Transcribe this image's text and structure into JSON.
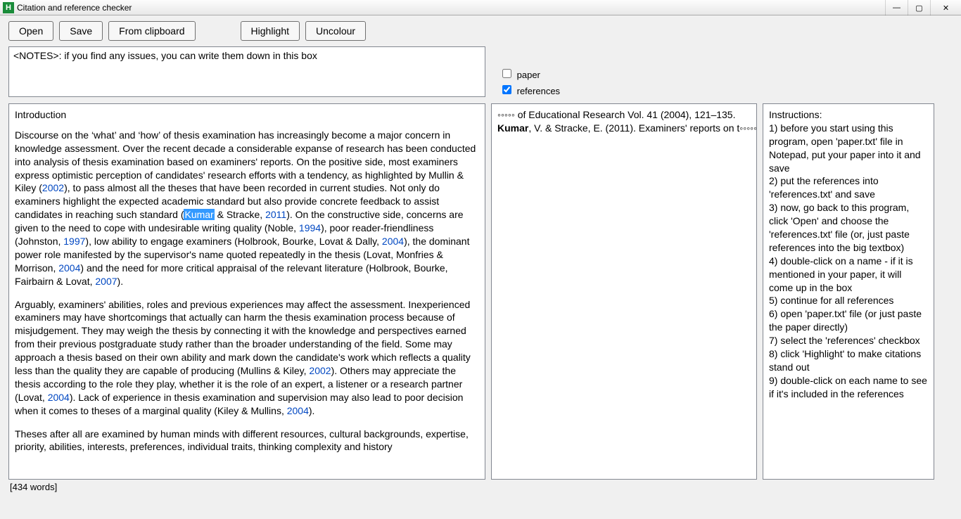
{
  "window": {
    "title": "Citation and reference checker",
    "icon_letter": "H"
  },
  "toolbar": {
    "open": "Open",
    "save": "Save",
    "from_clipboard": "From clipboard",
    "highlight": "Highlight",
    "uncolour": "Uncolour"
  },
  "notes_value": "<NOTES>: if you find any issues, you can write them down in this box",
  "checkboxes": {
    "paper_label": "paper",
    "paper_checked": false,
    "references_label": "references",
    "references_checked": true
  },
  "paper": {
    "heading": "Introduction",
    "p1a": "Discourse on the ‘what’ and ‘how’ of thesis examination has increasingly become a major concern in knowledge assessment. Over the recent decade a considerable expanse of research has been conducted into analysis of thesis examination based on examiners' reports. On the positive side, most examiners express optimistic perception of candidates' research efforts with a tendency, as highlighted by Mullin & Kiley (",
    "c1": "2002",
    "p1b": "), to pass almost all the theses that have been recorded in current studies. Not only do examiners highlight the expected academic standard but also provide concrete feedback to assist candidates in reaching such standard (",
    "c2": "Kumar",
    "p1c": " & Stracke, ",
    "c3": "2011",
    "p1d": "). On the constructive side, concerns are given to the need to cope with undesirable writing quality (Noble, ",
    "c4": "1994",
    "p1e": "), poor reader-friendliness (Johnston, ",
    "c5": "1997",
    "p1f": "), low ability to engage examiners (Holbrook, Bourke, Lovat & Dally, ",
    "c6": "2004",
    "p1g": "), the dominant power role manifested by the supervisor's name quoted repeatedly in the thesis (Lovat, Monfries & Morrison, ",
    "c7": "2004",
    "p1h": ") and the need for more critical appraisal of the relevant literature (Holbrook, Bourke, Fairbairn & Lovat, ",
    "c8": "2007",
    "p1i": ").",
    "p2a": "Arguably, examiners' abilities, roles and previous experiences may affect the assessment. Inexperienced examiners may have shortcomings that actually can harm the thesis examination process because of misjudgement. They may weigh the thesis by connecting it with the knowledge and perspectives earned from their previous postgraduate study rather than the broader understanding of the field. Some may approach a thesis based on their own ability and mark down the candidate's work which reflects a quality less than the quality they are capable of producing (Mullins & Kiley, ",
    "c9": "2002",
    "p2b": "). Others may appreciate the thesis according to the role they play, whether it is the role of an expert, a listener or a research partner (Lovat, ",
    "c10": "2004",
    "p2c": "). Lack of experience in thesis examination and supervision may also lead to poor decision when it comes to theses of a marginal quality (Kiley & Mullins, ",
    "c11": "2004",
    "p2d": ").",
    "p3": "Theses after all are examined by human minds with different resources, cultural backgrounds, expertise, priority, abilities, interests, preferences, individual traits, thinking complexity and history"
  },
  "references": {
    "line1": "◦◦◦◦◦ of Educational Research Vol. 41 (2004), 121–135.",
    "line2a": "Kumar",
    "line2b": ", V. & Stracke, E. (2011). Examiners' reports on t◦◦◦◦◦"
  },
  "instructions": {
    "title": "Instructions:",
    "i1": "1) before you start using this program, open 'paper.txt' file in Notepad, put your paper into it and save",
    "i2": "2) put the references into 'references.txt' and save",
    "i3": "3) now, go back to this program, click 'Open' and choose the 'references.txt' file (or, just paste references into the big textbox)",
    "i4": "4) double-click on a name - if it is mentioned in your paper, it will come up in the box",
    "i5": "5) continue for all references",
    "i6": "6) open 'paper.txt' file (or just paste the paper directly)",
    "i7": "7) select the 'references' checkbox",
    "i8": "8) click 'Highlight' to make citations stand out",
    "i9": "9) double-click on each name to see if it's included in the references"
  },
  "status": {
    "words": "[434 words]"
  }
}
